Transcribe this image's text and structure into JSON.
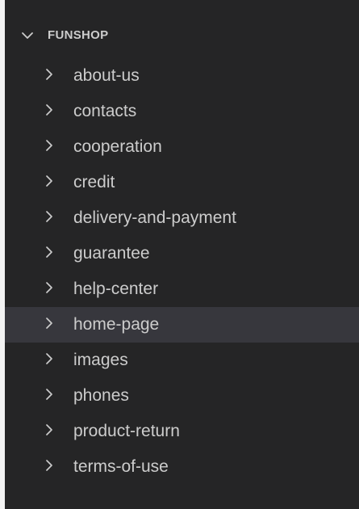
{
  "explorer": {
    "section_title": "FUNSHOP",
    "section_icon": "chevron-down-icon",
    "folder_icon": "chevron-right-icon",
    "selected_folder": "home-page",
    "colors": {
      "background": "#252526",
      "selected_background": "#37373d",
      "text": "#cccccc",
      "outer_border": "#f3f3f3"
    },
    "folders": [
      {
        "label": "about-us"
      },
      {
        "label": "contacts"
      },
      {
        "label": "cooperation"
      },
      {
        "label": "credit"
      },
      {
        "label": "delivery-and-payment"
      },
      {
        "label": "guarantee"
      },
      {
        "label": "help-center"
      },
      {
        "label": "home-page"
      },
      {
        "label": "images"
      },
      {
        "label": "phones"
      },
      {
        "label": "product-return"
      },
      {
        "label": "terms-of-use"
      }
    ]
  }
}
